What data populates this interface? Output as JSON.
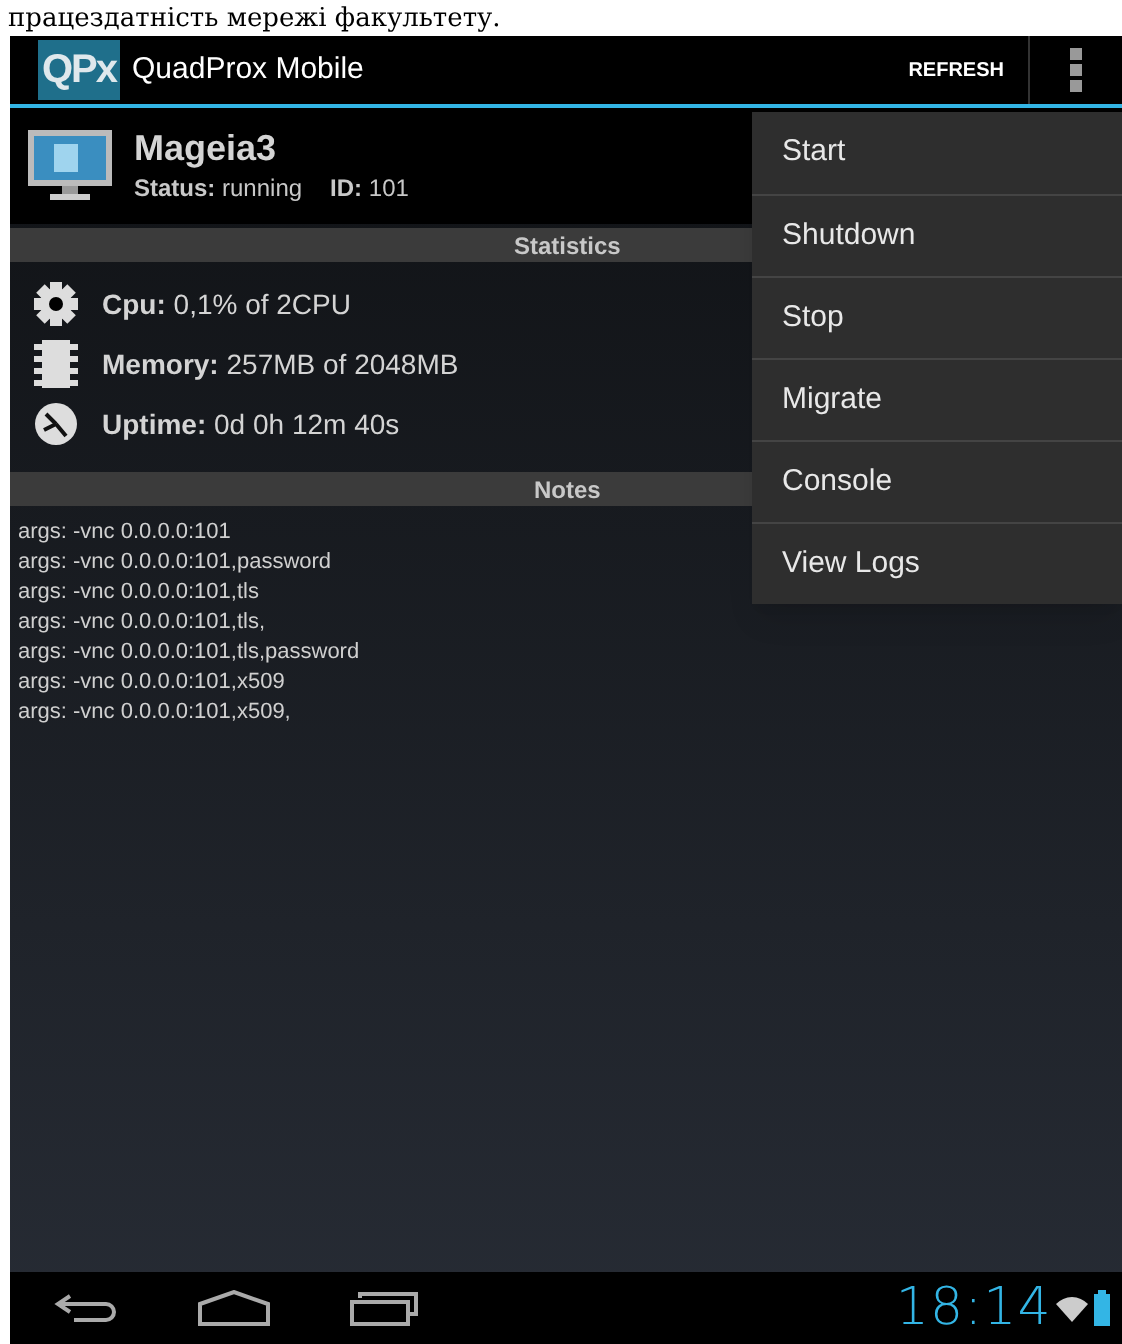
{
  "caption": "працездатність мережі факультету.",
  "action_bar": {
    "logo": "QPx",
    "title": "QuadProx Mobile",
    "refresh": "REFRESH"
  },
  "vm": {
    "name": "Mageia3",
    "status_label": "Status:",
    "status": "running",
    "id_label": "ID:",
    "id": "101"
  },
  "statistics": {
    "header": "Statistics",
    "rows": [
      {
        "kind": "cpu",
        "label": "Cpu:",
        "value": "0,1% of 2CPU"
      },
      {
        "kind": "memory",
        "label": "Memory:",
        "value": "257MB of 2048MB"
      },
      {
        "kind": "uptime",
        "label": "Uptime:",
        "value": "0d 0h 12m 40s"
      }
    ]
  },
  "notes": {
    "header": "Notes",
    "lines": [
      "args: -vnc 0.0.0.0:101",
      "args: -vnc 0.0.0.0:101,password",
      "args: -vnc 0.0.0.0:101,tls",
      "args: -vnc 0.0.0.0:101,tls,",
      "args: -vnc 0.0.0.0:101,tls,password",
      "args: -vnc 0.0.0.0:101,x509",
      "args: -vnc 0.0.0.0:101,x509,"
    ]
  },
  "menu": [
    "Start",
    "Shutdown",
    "Stop",
    "Migrate",
    "Console",
    "View Logs"
  ],
  "status_bar": {
    "time": "18:14"
  }
}
